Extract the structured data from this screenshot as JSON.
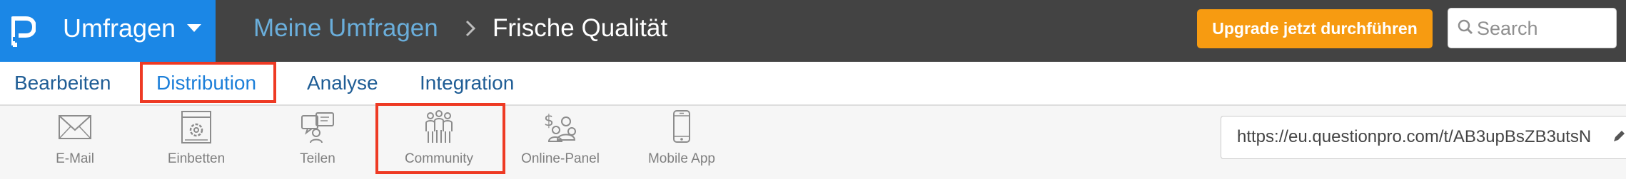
{
  "app": {
    "name": "Umfragen"
  },
  "breadcrumb": {
    "root": "Meine Umfragen",
    "current": "Frische Qualität"
  },
  "header": {
    "upgrade_label": "Upgrade jetzt durchführen",
    "search_placeholder": "Search"
  },
  "tabs": [
    {
      "label": "Bearbeiten",
      "active": false
    },
    {
      "label": "Distribution",
      "active": true
    },
    {
      "label": "Analyse",
      "active": false
    },
    {
      "label": "Integration",
      "active": false
    }
  ],
  "toolbar": {
    "items": [
      {
        "label": "E-Mail",
        "icon": "envelope-icon"
      },
      {
        "label": "Einbetten",
        "icon": "embed-icon"
      },
      {
        "label": "Teilen",
        "icon": "share-icon"
      },
      {
        "label": "Community",
        "icon": "community-icon"
      },
      {
        "label": "Online-Panel",
        "icon": "online-panel-icon"
      },
      {
        "label": "Mobile App",
        "icon": "mobile-app-icon"
      }
    ],
    "survey_url": "https://eu.questionpro.com/t/AB3upBsZB3utsN"
  },
  "colors": {
    "brand": "#1b87e6",
    "header_bg": "#434343",
    "upgrade": "#f79b11",
    "tab_text": "#1f5d95",
    "highlight": "#ee3a24"
  }
}
